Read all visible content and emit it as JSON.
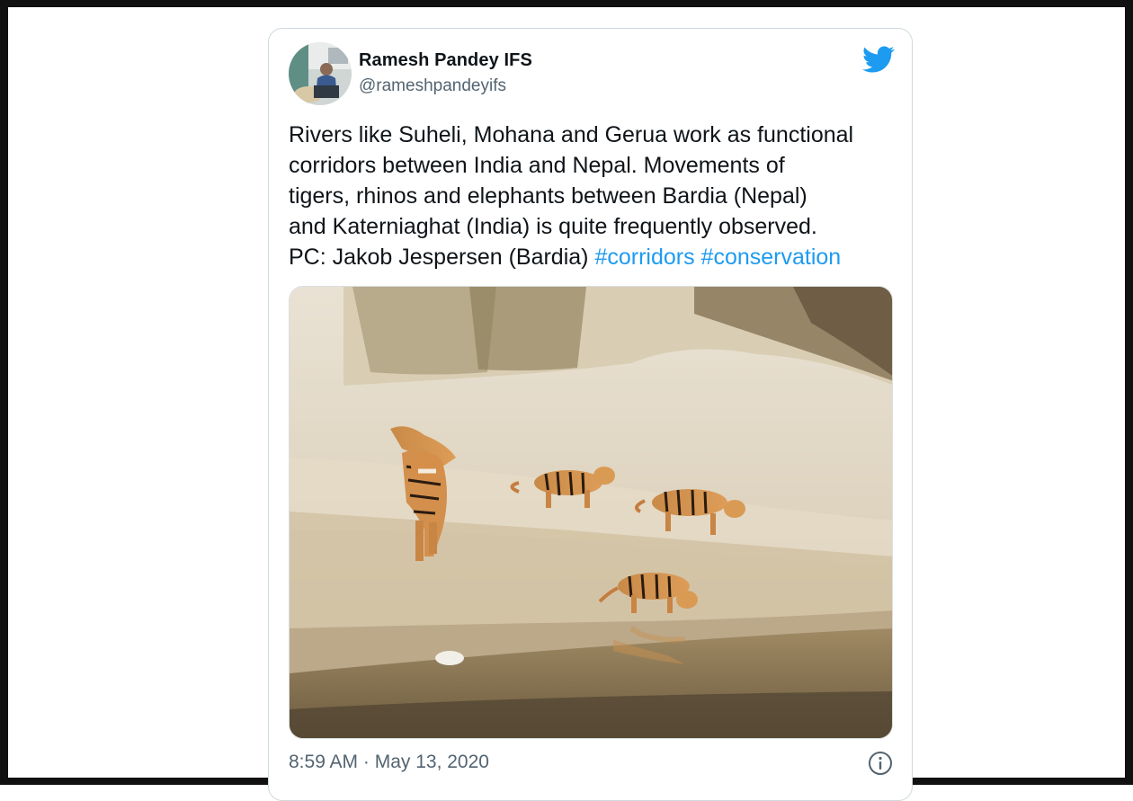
{
  "tweet": {
    "author_name": "Ramesh Pandey IFS",
    "author_handle": "@rameshpandeyifs",
    "text_lines": [
      "Rivers like Suheli, Mohana and Gerua work as functional",
      "corridors between India and Nepal. Movements of",
      "tigers, rhinos and elephants between Bardia (Nepal)",
      "and Katerniaghat (India) is quite frequently observed.",
      "PC: Jakob Jespersen (Bardia) "
    ],
    "hashtags": [
      "#corridors",
      "#conservation"
    ],
    "timestamp": "8:59 AM · May 13, 2020",
    "photo_subject": "tigers-on-riverbank-photo"
  },
  "icons": {
    "brand": "twitter-bird-icon",
    "info": "info-icon"
  },
  "colors": {
    "link": "#1d9bf0",
    "text": "#0f1419",
    "secondary": "#536471",
    "border": "#cfd9de",
    "frame": "#111111"
  }
}
